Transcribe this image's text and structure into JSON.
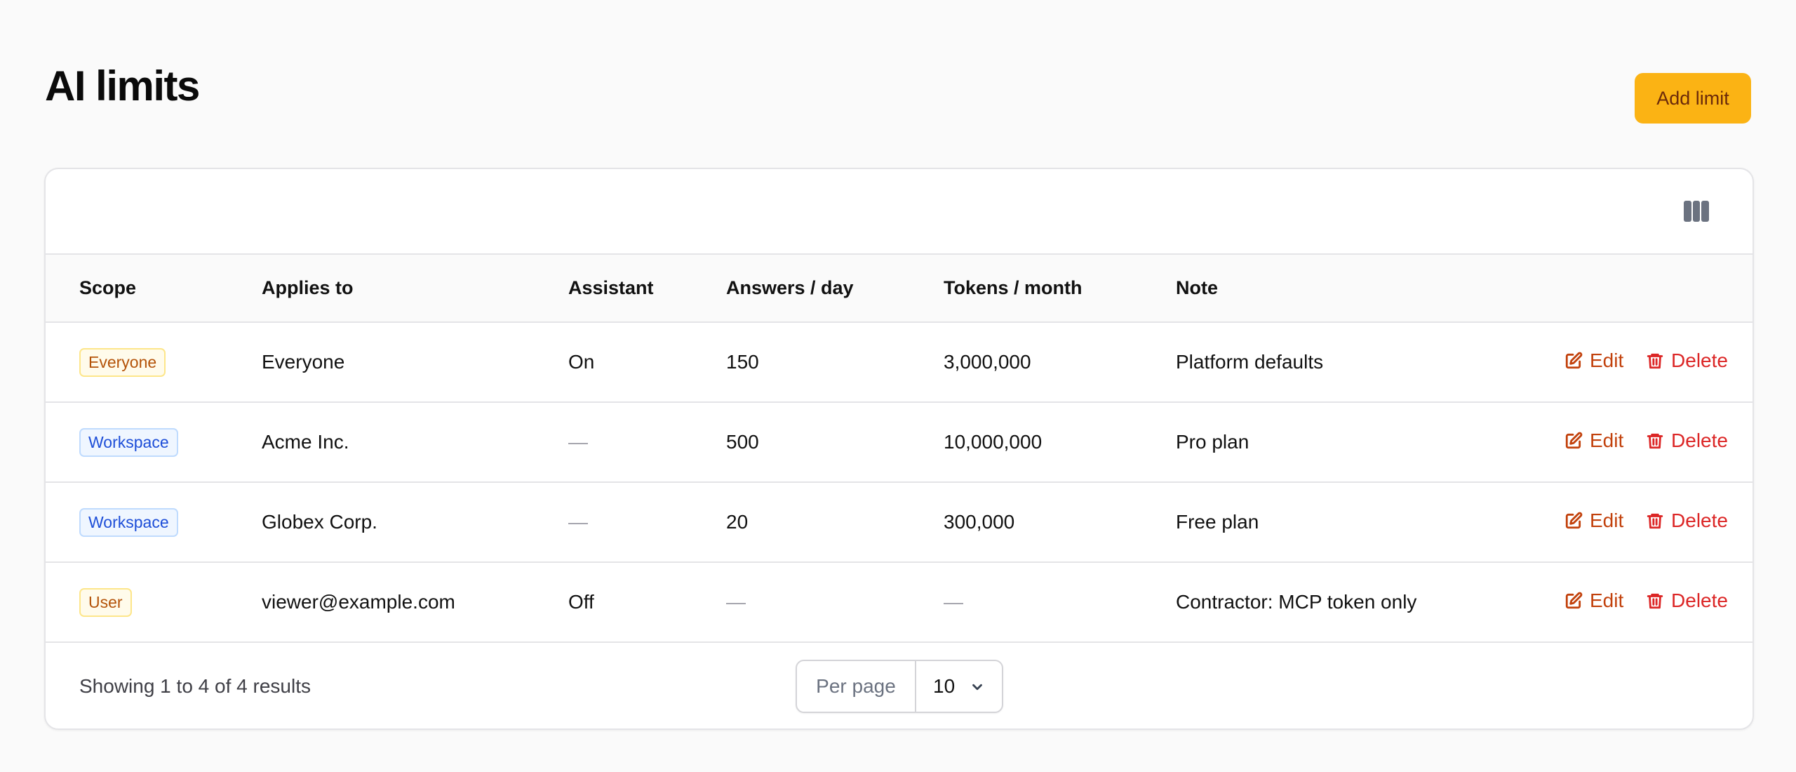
{
  "page": {
    "title": "AI limits",
    "add_button": "Add limit"
  },
  "table": {
    "columns": [
      "Scope",
      "Applies to",
      "Assistant",
      "Answers / day",
      "Tokens / month",
      "Note"
    ],
    "rows": [
      {
        "scope": "Everyone",
        "applies_to": "Everyone",
        "assistant": "On",
        "answers_per_day": "150",
        "tokens_per_month": "3,000,000",
        "note": "Platform defaults"
      },
      {
        "scope": "Workspace",
        "applies_to": "Acme Inc.",
        "assistant": "—",
        "answers_per_day": "500",
        "tokens_per_month": "10,000,000",
        "note": "Pro plan"
      },
      {
        "scope": "Workspace",
        "applies_to": "Globex Corp.",
        "assistant": "—",
        "answers_per_day": "20",
        "tokens_per_month": "300,000",
        "note": "Free plan"
      },
      {
        "scope": "User",
        "applies_to": "viewer@example.com",
        "assistant": "Off",
        "answers_per_day": "—",
        "tokens_per_month": "—",
        "note": "Contractor: MCP token only"
      }
    ],
    "row_actions": {
      "edit": "Edit",
      "delete": "Delete"
    }
  },
  "footer": {
    "results": "Showing 1 to 4 of 4 results",
    "per_page_label": "Per page",
    "per_page_value": "10"
  },
  "icons": {
    "columns_toggle": "columns-icon",
    "edit": "pencil-square-icon",
    "delete": "trash-icon",
    "per_page_caret": "chevron-down-icon"
  },
  "colors": {
    "accent": "#fbb314",
    "edit": "#c2410c",
    "delete": "#dc2626",
    "badge_blue": "#1d4ed8",
    "badge_amber": "#b45309"
  }
}
